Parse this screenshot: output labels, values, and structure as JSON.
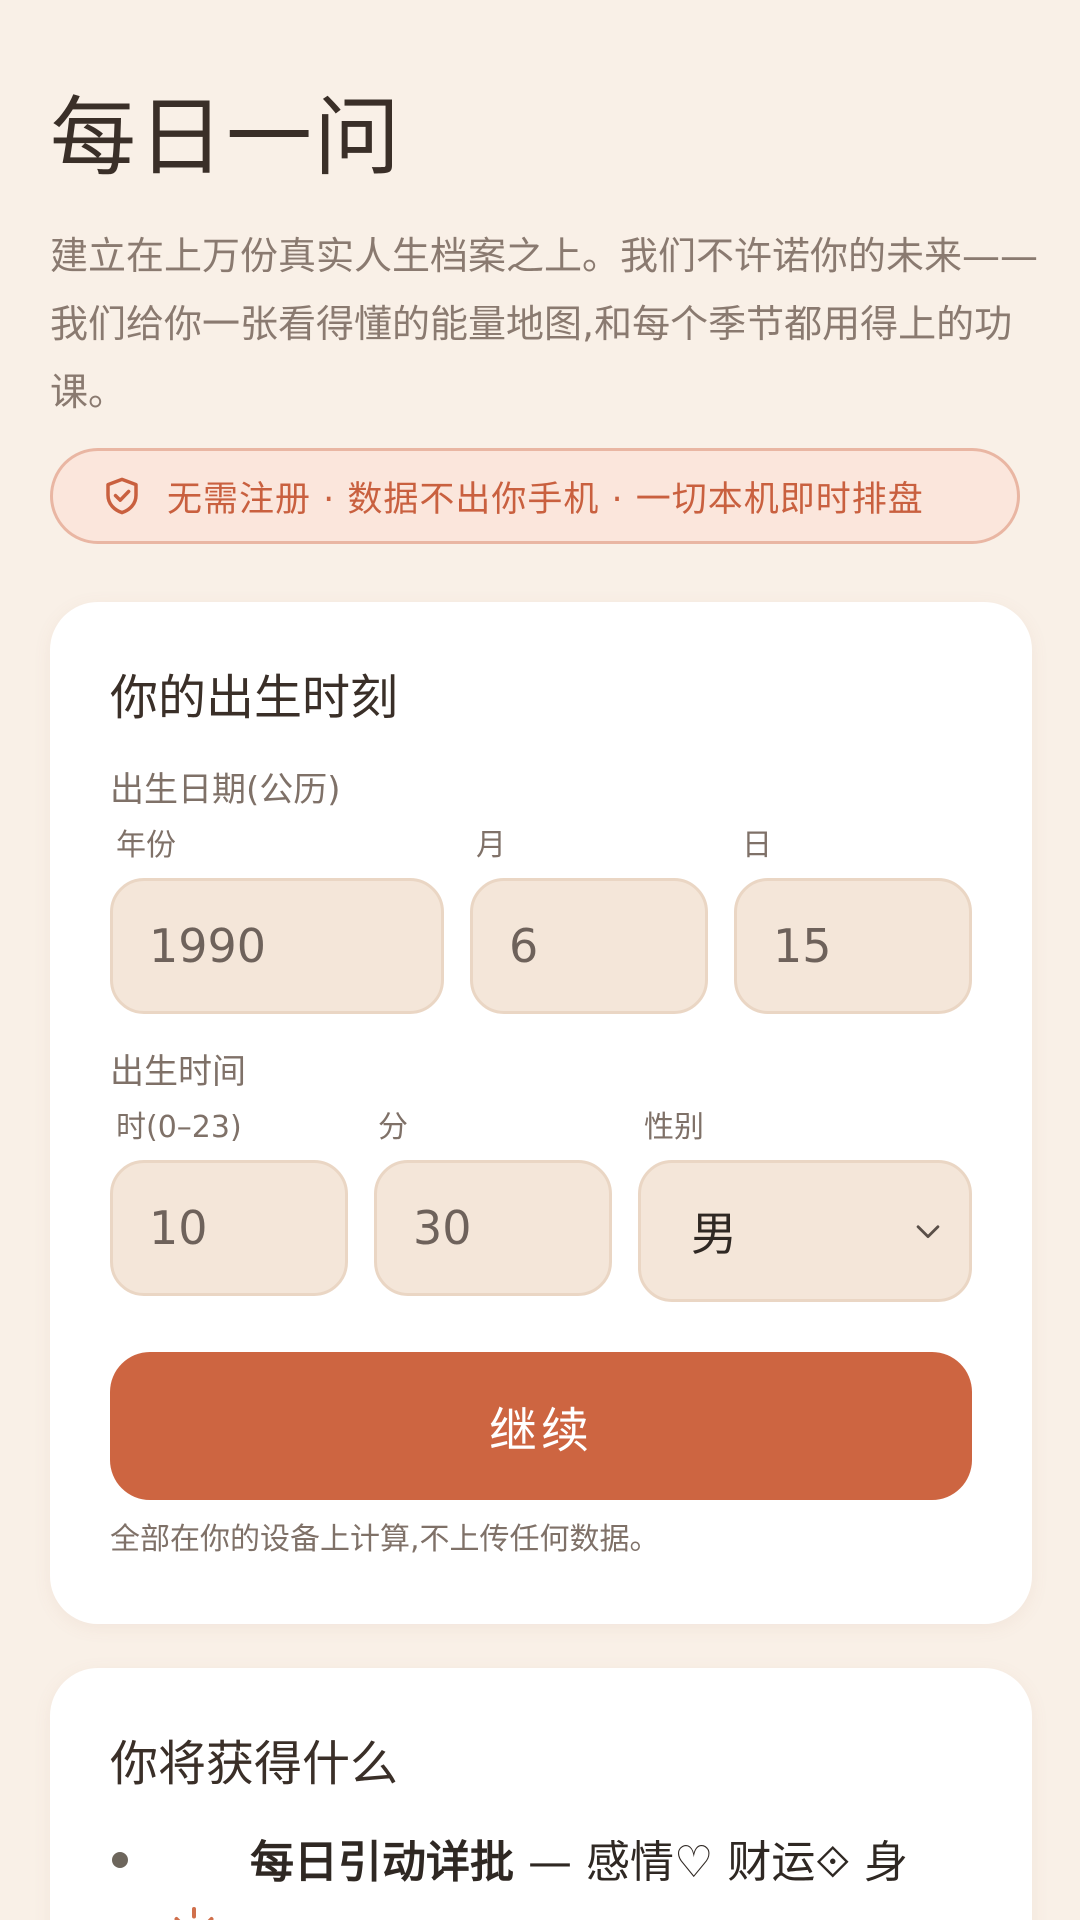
{
  "header": {
    "title": "每日一问",
    "intro": "建立在上万份真实人生档案之上。我们不许诺你的未来——我们给你一张看得懂的能量地图,和每个季节都用得上的功课。"
  },
  "privacy": {
    "icon": "shield-check-icon",
    "text": "无需注册 · 数据不出你手机 · 一切本机即时排盘",
    "color": "#c9603f"
  },
  "form": {
    "title": "你的出生时刻",
    "date_section": "出生日期(公历)",
    "year_label": "年份",
    "year_value": "1990",
    "month_label": "月",
    "month_value": "6",
    "day_label": "日",
    "day_value": "15",
    "time_section": "出生时间",
    "hour_label": "时(0–23)",
    "hour_value": "10",
    "minute_label": "分",
    "minute_value": "30",
    "gender_label": "性别",
    "gender_value": "男",
    "continue_label": "继续",
    "note": "全部在你的设备上计算,不上传任何数据。",
    "accent": "#cd6541"
  },
  "benefits": {
    "title": "你将获得什么",
    "items": [
      {
        "title": "每日引动详批",
        "text": " — 感情♡ 财运⟐ 身"
      }
    ]
  }
}
